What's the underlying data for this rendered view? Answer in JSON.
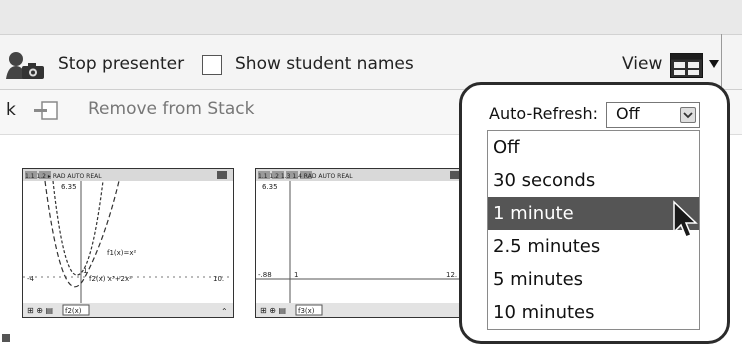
{
  "toolbar": {
    "stop_presenter_label": "Stop presenter",
    "show_student_names_label": "Show student names",
    "view_label": "View"
  },
  "stack_bar": {
    "cut_text": "k",
    "remove_from_stack_label": "Remove from Stack"
  },
  "thumbnails": [
    {
      "header": "1.1  1.2  ▸  RAD AUTO REAL",
      "y_top_label": "6.35",
      "f1_label": "f1(x)=x²",
      "f2_label": "f2(x)  x³+2x²",
      "x_left_label": "-4",
      "x_right_label": "10.",
      "origin_label": "1",
      "entry_label": "f2(x)"
    },
    {
      "header": "1.1  1.2  1.3  1.4  RAD AUTO REAL",
      "y_top_label": "6.35",
      "x_left_label": "-.88",
      "x_right_label": "12.",
      "origin_label": "1",
      "entry_label": "f3(x)"
    }
  ],
  "auto_refresh": {
    "label": "Auto-Refresh:",
    "selected": "Off",
    "options": [
      "Off",
      "30 seconds",
      "1 minute",
      "2.5 minutes",
      "5 minutes",
      "10 minutes"
    ],
    "highlighted": "1 minute"
  },
  "colors": {
    "highlight_bg": "#555555",
    "toolbar_bg": "#f4f4f4",
    "frame_border": "#2b2b2b"
  },
  "icons": [
    "presenter-camera-icon",
    "view-layout-icon",
    "remove-stack-icon",
    "dropdown-arrow-icon",
    "mouse-pointer-icon"
  ]
}
